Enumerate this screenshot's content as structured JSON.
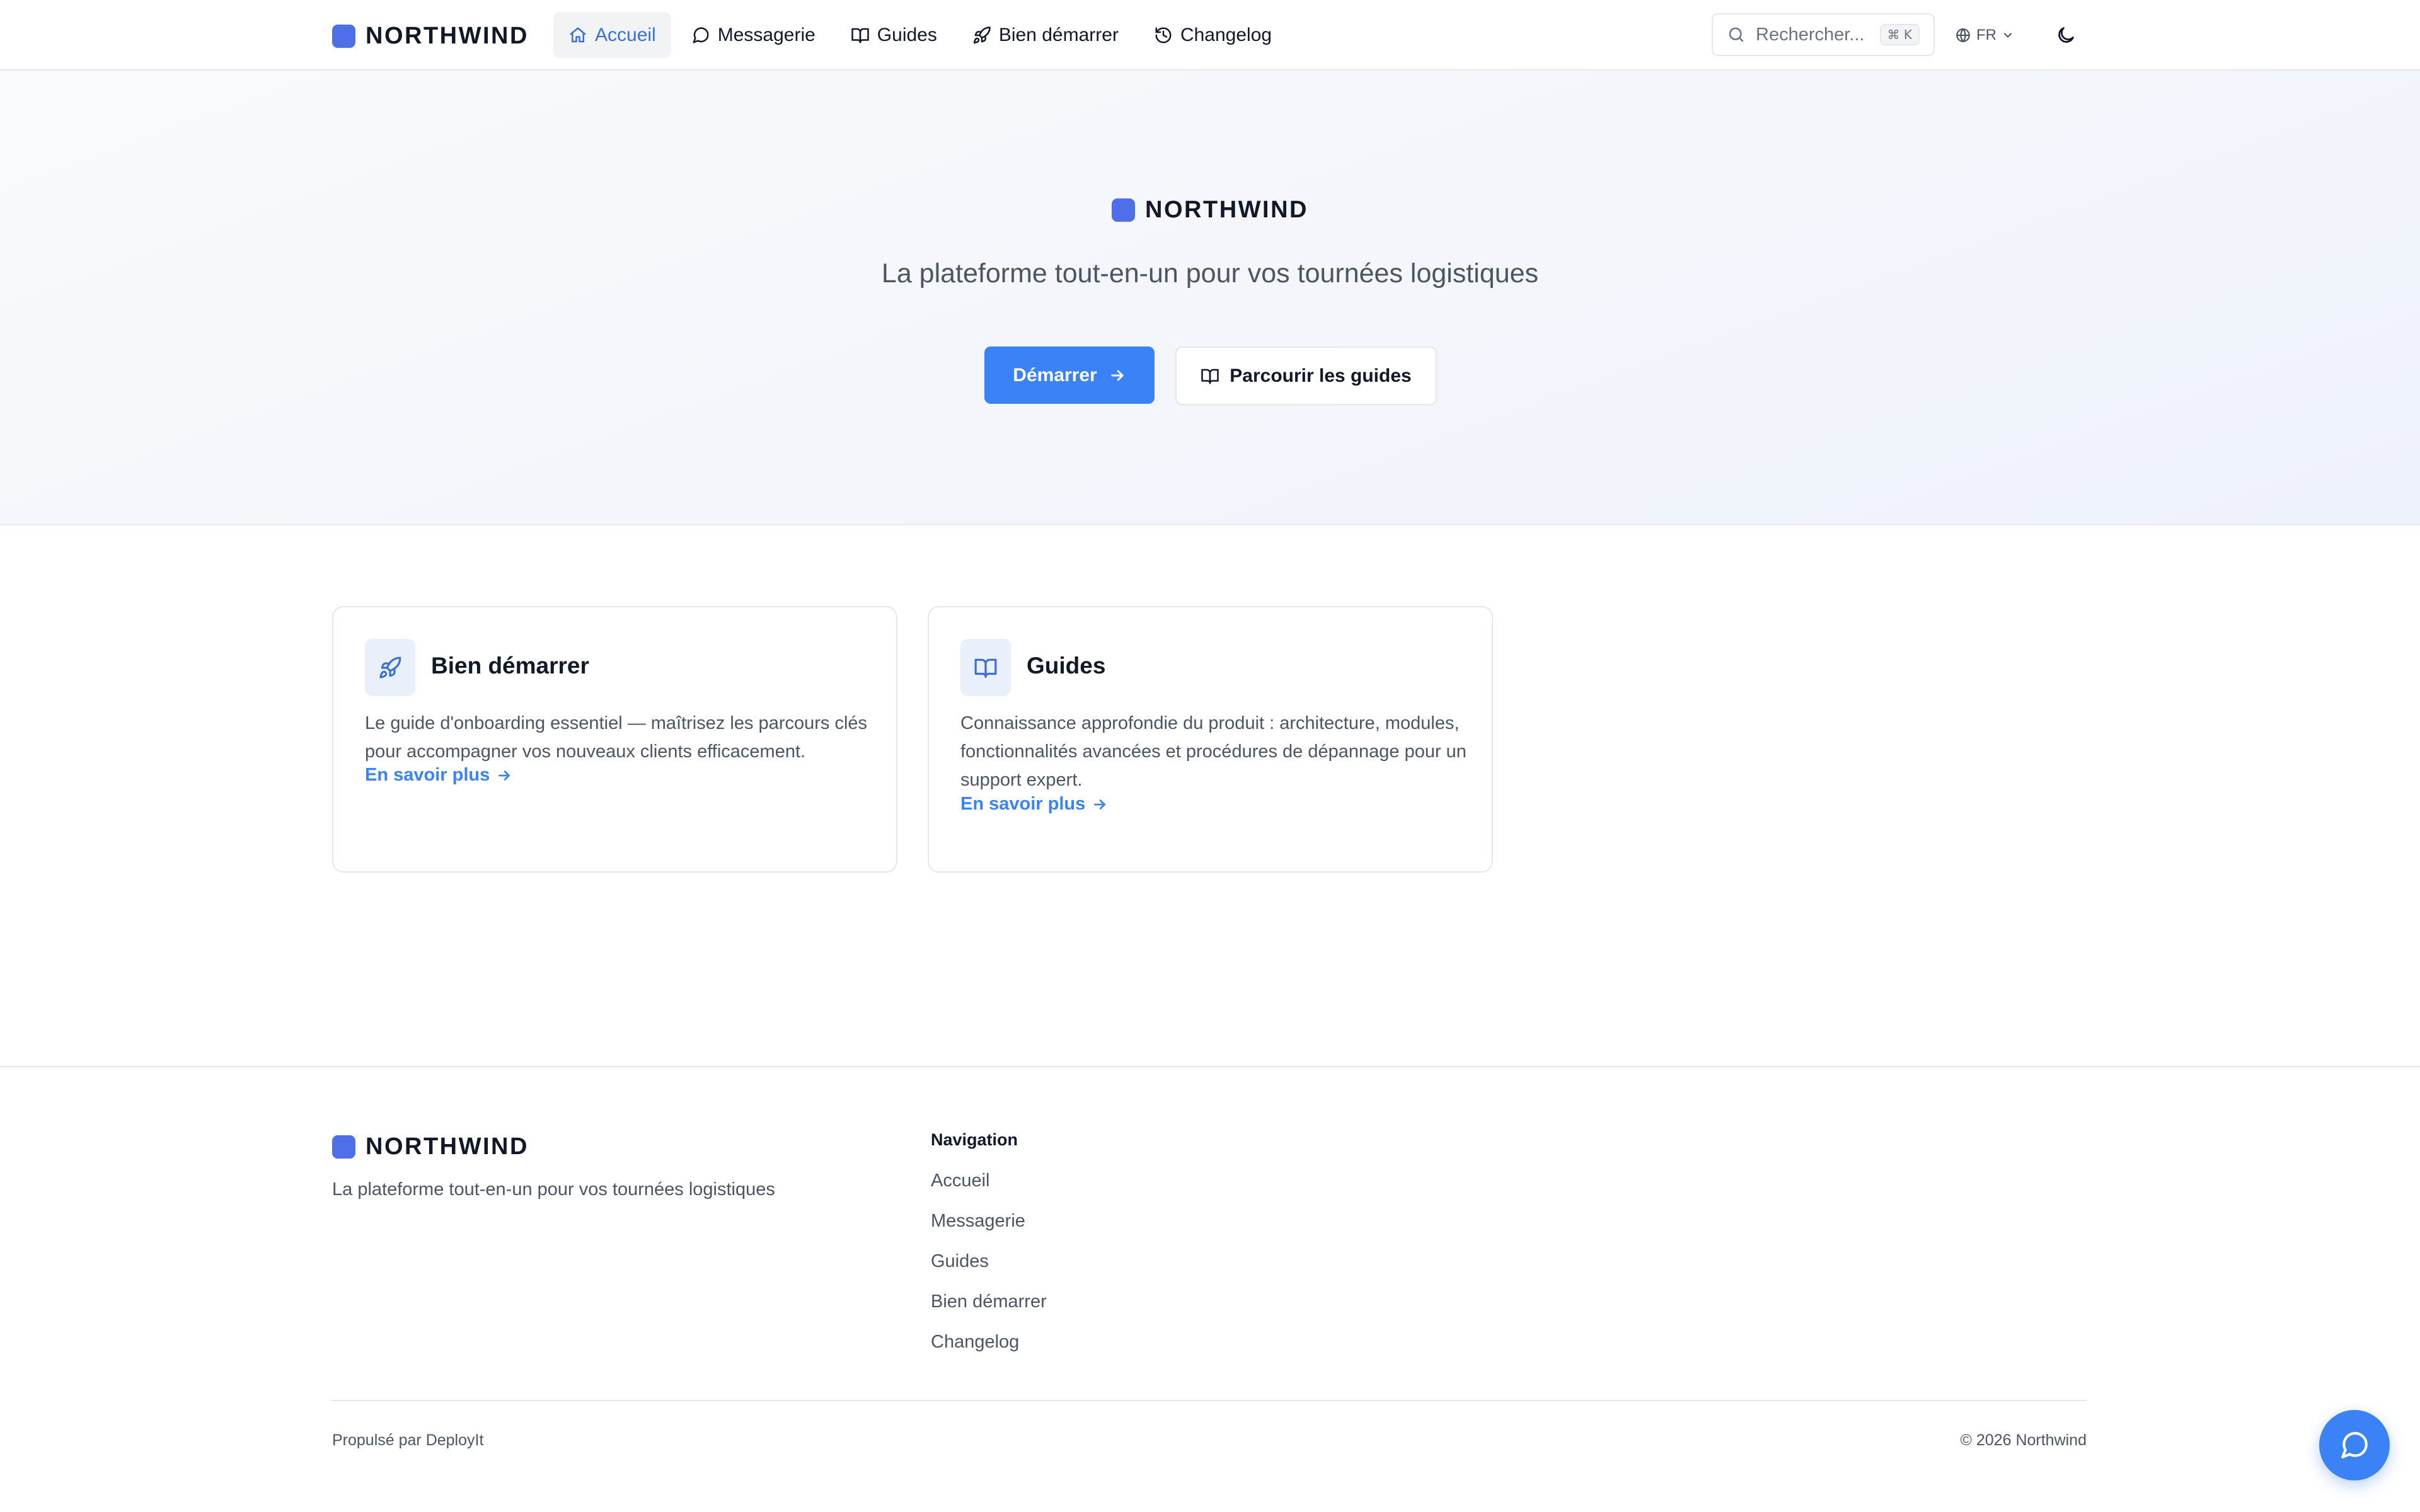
{
  "brand": {
    "name": "NORTHWIND",
    "tagline": "La plateforme tout-en-un pour vos tournées logistiques",
    "accent_color": "#4f6fea"
  },
  "header": {
    "nav": [
      {
        "label": "Accueil",
        "icon": "home-icon",
        "active": true
      },
      {
        "label": "Messagerie",
        "icon": "message-circle-icon",
        "active": false
      },
      {
        "label": "Guides",
        "icon": "book-open-icon",
        "active": false
      },
      {
        "label": "Bien démarrer",
        "icon": "rocket-icon",
        "active": false
      },
      {
        "label": "Changelog",
        "icon": "history-icon",
        "active": false
      }
    ],
    "search": {
      "placeholder": "Rechercher...",
      "shortcut": "⌘ K",
      "icon": "search-icon"
    },
    "language": {
      "value": "FR",
      "icon": "globe-icon"
    },
    "theme_toggle": {
      "icon": "moon-icon"
    }
  },
  "hero": {
    "primary_button": "Démarrer",
    "secondary_button": "Parcourir les guides",
    "primary_color": "#3b82f6"
  },
  "cards": [
    {
      "title": "Bien démarrer",
      "icon": "rocket-icon",
      "description": "Le guide d'onboarding essentiel — maîtrisez les parcours clés pour accompagner vos nouveaux clients efficacement.",
      "link": "En savoir plus"
    },
    {
      "title": "Guides",
      "icon": "book-open-icon",
      "description": "Connaissance approfondie du produit : architecture, modules, fonctionnalités avancées et procédures de dépannage pour un support expert.",
      "link": "En savoir plus"
    }
  ],
  "footer": {
    "nav_title": "Navigation",
    "nav_items": [
      "Accueil",
      "Messagerie",
      "Guides",
      "Bien démarrer",
      "Changelog"
    ],
    "powered_by": "Propulsé par DeployIt",
    "copyright": "© 2026 Northwind"
  },
  "chat": {
    "icon": "chat-bubble-icon"
  }
}
